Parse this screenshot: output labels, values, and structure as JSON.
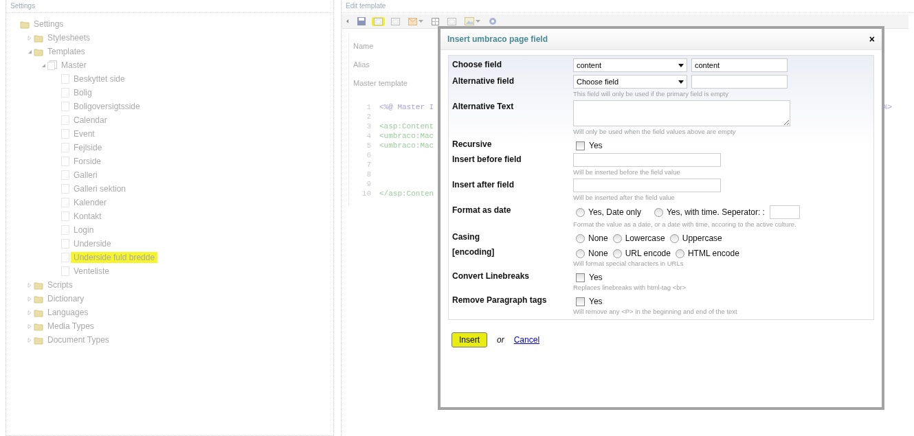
{
  "left_panel": {
    "header": "Settings",
    "tree": [
      {
        "label": "Settings",
        "kind": "folder",
        "highlighted": false,
        "children": [
          {
            "label": "Stylesheets",
            "kind": "folder",
            "expanded": false,
            "highlighted": false
          },
          {
            "label": "Templates",
            "kind": "folder",
            "expanded": true,
            "highlighted": false,
            "children": [
              {
                "label": "Master",
                "kind": "master",
                "expanded": true,
                "highlighted": false,
                "children": [
                  {
                    "label": "Beskyttet side",
                    "kind": "template",
                    "highlighted": false
                  },
                  {
                    "label": "Bolig",
                    "kind": "template",
                    "highlighted": false
                  },
                  {
                    "label": "Boligoversigtsside",
                    "kind": "template",
                    "highlighted": false
                  },
                  {
                    "label": "Calendar",
                    "kind": "template",
                    "highlighted": false
                  },
                  {
                    "label": "Event",
                    "kind": "template",
                    "highlighted": false
                  },
                  {
                    "label": "Fejlside",
                    "kind": "template",
                    "highlighted": false
                  },
                  {
                    "label": "Forside",
                    "kind": "template",
                    "highlighted": false
                  },
                  {
                    "label": "Galleri",
                    "kind": "template",
                    "highlighted": false
                  },
                  {
                    "label": "Galleri sektion",
                    "kind": "template",
                    "highlighted": false
                  },
                  {
                    "label": "Kalender",
                    "kind": "template",
                    "highlighted": false
                  },
                  {
                    "label": "Kontakt",
                    "kind": "template",
                    "highlighted": false
                  },
                  {
                    "label": "Login",
                    "kind": "template",
                    "highlighted": false
                  },
                  {
                    "label": "Underside",
                    "kind": "template",
                    "highlighted": false
                  },
                  {
                    "label": "Underside fuld bredde",
                    "kind": "template",
                    "highlighted": true
                  },
                  {
                    "label": "Venteliste",
                    "kind": "template",
                    "highlighted": false
                  }
                ]
              }
            ]
          },
          {
            "label": "Scripts",
            "kind": "folder",
            "expanded": false,
            "highlighted": false
          },
          {
            "label": "Dictionary",
            "kind": "folder",
            "expanded": false,
            "highlighted": false
          },
          {
            "label": "Languages",
            "kind": "folder",
            "expanded": false,
            "highlighted": false
          },
          {
            "label": "Media Types",
            "kind": "folder",
            "expanded": false,
            "highlighted": false
          },
          {
            "label": "Document Types",
            "kind": "folder",
            "expanded": false,
            "highlighted": false
          }
        ]
      }
    ]
  },
  "right_panel": {
    "header": "Edit template",
    "toolbar": [
      {
        "kind": "arrow",
        "dropdown": false,
        "highlighted": false
      },
      {
        "kind": "disk",
        "dropdown": false,
        "highlighted": false
      },
      {
        "kind": "frame",
        "dropdown": false,
        "highlighted": true
      },
      {
        "kind": "frame",
        "dropdown": false,
        "highlighted": false
      },
      {
        "kind": "envelope",
        "dropdown": true,
        "highlighted": false
      },
      {
        "kind": "grid",
        "dropdown": false,
        "highlighted": false
      },
      {
        "kind": "frame",
        "dropdown": false,
        "highlighted": false
      },
      {
        "kind": "image",
        "dropdown": true,
        "highlighted": false
      },
      {
        "kind": "gear",
        "dropdown": false,
        "highlighted": false
      }
    ],
    "properties": [
      "Name",
      "Alias",
      "Master template"
    ],
    "code_lines": [
      {
        "number": "1",
        "kind": "directive",
        "text": "<%@ Master I",
        "tail": "%>"
      },
      {
        "number": "2"
      },
      {
        "number": "3",
        "kind": "tag",
        "text": "<asp:Content"
      },
      {
        "number": "4",
        "kind": "tag",
        "text": "<umbraco:Mac"
      },
      {
        "number": "5",
        "kind": "tag",
        "text": "<umbraco:Mac"
      },
      {
        "number": "6"
      },
      {
        "number": "7"
      },
      {
        "number": "8"
      },
      {
        "number": "9"
      },
      {
        "number": "10",
        "kind": "tag",
        "text": "</asp:Conten"
      }
    ]
  },
  "dialog": {
    "title": "Insert umbraco page field",
    "close": "×",
    "fields": [
      {
        "kind": "select_input",
        "label": "Choose field",
        "select": "content",
        "value": "content"
      },
      {
        "kind": "select_input",
        "label": "Alternative field",
        "select": "Choose field",
        "hint": "This field will only be used if the primary field is empty"
      },
      {
        "kind": "textarea",
        "label": "Alternative Text",
        "hint": "Will only be used when the field values above are empty"
      },
      {
        "kind": "checkbox",
        "label": "Recursive",
        "option": "Yes",
        "checked": false
      },
      {
        "kind": "input",
        "label": "Insert before field",
        "hint": "Will be inserted before the field value"
      },
      {
        "kind": "input",
        "label": "Insert after field",
        "hint": "Will be inserted after the field value"
      },
      {
        "kind": "radios_input",
        "label": "Format as date",
        "options": [
          {
            "label": "Yes, Date only",
            "selected": false
          },
          {
            "label": "Yes, with time. Seperator: :",
            "selected": false
          }
        ],
        "hint": "Format the value as a date, or a date with time, accoring to the active culture."
      },
      {
        "kind": "radios",
        "label": "Casing",
        "options": [
          {
            "label": "None",
            "selected": false
          },
          {
            "label": "Lowercase",
            "selected": false
          },
          {
            "label": "Uppercase",
            "selected": false
          }
        ]
      },
      {
        "kind": "radios",
        "label": "[encoding]",
        "options": [
          {
            "label": "None",
            "selected": false
          },
          {
            "label": "URL encode",
            "selected": false
          },
          {
            "label": "HTML encode",
            "selected": false
          }
        ],
        "hint": "Will format special characters in URLs"
      },
      {
        "kind": "checkbox",
        "label": "Convert Linebreaks",
        "option": "Yes",
        "checked": false,
        "hint": "Replaces linebreaks with html-tag <br>"
      },
      {
        "kind": "checkbox",
        "label": "Remove Paragraph tags",
        "option": "Yes",
        "checked": false,
        "hint": "Will remove any <P> in the beginning and end of the text"
      }
    ],
    "insert_button": {
      "label": "Insert",
      "highlighted": true
    },
    "or": "or",
    "cancel": "Cancel"
  }
}
